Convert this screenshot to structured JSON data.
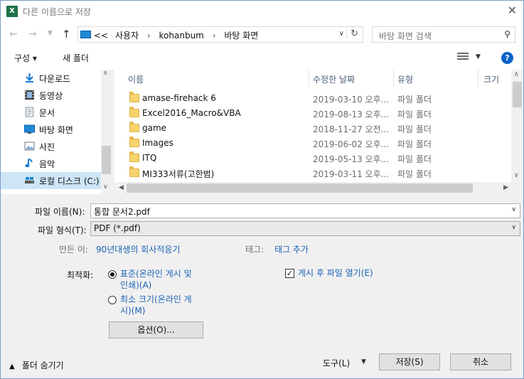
{
  "window": {
    "title": "다른 이름으로 저장",
    "app_icon": "X",
    "close_glyph": "✕"
  },
  "nav": {
    "breadcrumb": [
      "<<",
      "사용자",
      "kohanbum",
      "바탕 화면"
    ],
    "search_placeholder": "바탕 화면 검색"
  },
  "toolbar": {
    "organize_label": "구성 ▾",
    "new_folder_label": "새 폴더"
  },
  "sidebar": {
    "items": [
      {
        "label": "다운로드",
        "icon": "download-icon"
      },
      {
        "label": "동영상",
        "icon": "video-icon"
      },
      {
        "label": "문서",
        "icon": "document-icon"
      },
      {
        "label": "바탕 화면",
        "icon": "desktop-icon"
      },
      {
        "label": "사진",
        "icon": "picture-icon"
      },
      {
        "label": "음악",
        "icon": "music-icon"
      },
      {
        "label": "로컬 디스크 (C:)",
        "icon": "disk-icon",
        "selected": true
      }
    ]
  },
  "files": {
    "columns": [
      "이름",
      "수정한 날짜",
      "유형",
      "크기"
    ],
    "rows": [
      {
        "name": "amase-firehack 6",
        "date": "2019-03-10 오후...",
        "type": "파일 폴더"
      },
      {
        "name": "Excel2016_Macro&VBA",
        "date": "2019-08-13 오후...",
        "type": "파일 폴더"
      },
      {
        "name": "game",
        "date": "2018-11-27 오전...",
        "type": "파일 폴더"
      },
      {
        "name": "Images",
        "date": "2019-06-02 오후...",
        "type": "파일 폴더"
      },
      {
        "name": "ITQ",
        "date": "2019-05-13 오후...",
        "type": "파일 폴더"
      },
      {
        "name": "MI333서류(고한범)",
        "date": "2019-03-11 오후...",
        "type": "파일 폴더"
      }
    ]
  },
  "form": {
    "filename_label": "파일 이름(N):",
    "filename_value": "통합 문서2.pdf",
    "filetype_label": "파일 형식(T):",
    "filetype_value": "PDF (*.pdf)",
    "author_label": "만든 이:",
    "author_value": "90년대생의 회사적응기",
    "tags_label": "태그:",
    "tags_value": "태그 추가",
    "optimize_label": "최적화:",
    "opt_standard": "표준(온라인 게시 및\n인쇄)(A)",
    "opt_minimum": "최소 크기(온라인 게\n시)(M)",
    "open_after_publish": "게시 후 파일 열기(E)",
    "options_button": "옵션(O)...",
    "hide_folders": "폴더 숨기기",
    "tools_label": "도구(L)",
    "save_button": "저장(S)",
    "cancel_button": "취소"
  },
  "colors": {
    "selected_bg": "#cde6f7",
    "link": "#1a62b5",
    "help": "#0a63c9",
    "folder": "#f7d36c"
  }
}
